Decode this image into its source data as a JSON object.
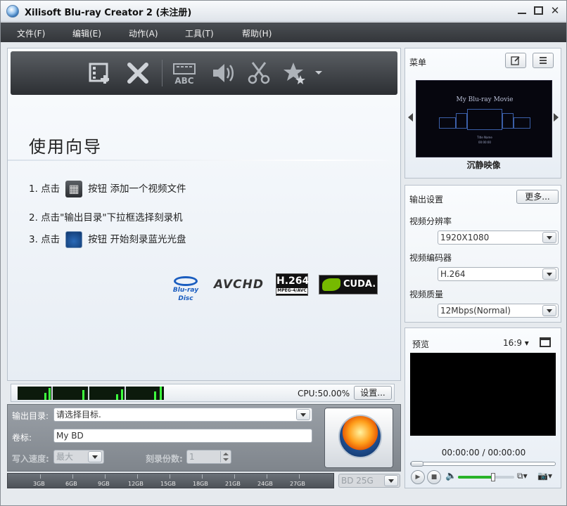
{
  "window": {
    "title": "Xilisoft Blu-ray Creator 2 (未注册)"
  },
  "menubar": {
    "items": [
      "文件(F)",
      "编辑(E)",
      "动作(A)",
      "工具(T)",
      "帮助(H)"
    ]
  },
  "toolbar": {
    "icons": [
      "add-video-icon",
      "delete-icon",
      "subtitle-icon",
      "audio-icon",
      "clip-icon",
      "effects-icon"
    ],
    "subtitle_glyph": "ABC"
  },
  "guide": {
    "title": "使用向导",
    "step1_pre": "1. 点击",
    "step1_post": "按钮  添加一个视频文件",
    "step2": "2. 点击\"输出目录\"下拉框选择刻录机",
    "step3_pre": "3. 点击",
    "step3_post": "按钮  开始刻录蓝光光盘"
  },
  "logos": {
    "bluray": "Blu-ray Disc",
    "avchd": "AVCHD",
    "h264": "H.264",
    "h264_sub": "MPEG-4/AVC",
    "cuda": "CUDA."
  },
  "cpu": {
    "text": "CPU:50.00%",
    "settings_label": "设置..."
  },
  "output": {
    "target_label": "输出目录:",
    "target_value": "请选择目标.",
    "volume_label": "卷标:",
    "volume_value": "My BD",
    "speed_label": "写入速度:",
    "speed_value": "最大",
    "copies_label": "刻录份数:",
    "copies_value": "1"
  },
  "capacity": {
    "ticks": [
      "3GB",
      "6GB",
      "9GB",
      "12GB",
      "15GB",
      "18GB",
      "21GB",
      "24GB",
      "27GB"
    ],
    "disc_type": "BD 25G"
  },
  "menu_panel": {
    "title": "菜单",
    "preview_title": "My Blu-ray Movie",
    "preview_sub_1": "Title Name",
    "preview_sub_2": "00:00:00",
    "template_name": "沉静映像"
  },
  "settings": {
    "title": "输出设置",
    "more_label": "更多...",
    "resolution_label": "视频分辨率",
    "resolution_value": "1920X1080",
    "encoder_label": "视频编码器",
    "encoder_value": "H.264",
    "quality_label": "视频质量",
    "quality_value": "12Mbps(Normal)"
  },
  "preview": {
    "title": "预览",
    "aspect": "16:9",
    "time": "00:00:00 / 00:00:00",
    "volume_level": 0.62
  },
  "colors": {
    "menubar": "#3a3d41",
    "cpu_graph": "#3dff3d",
    "volume_fill": "#29b329",
    "close": "#cc2a2a"
  }
}
